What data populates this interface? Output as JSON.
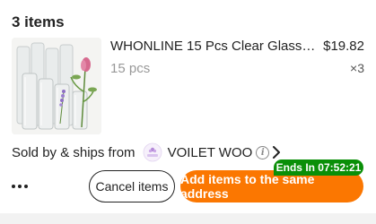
{
  "section": {
    "items_count": "3 items"
  },
  "product": {
    "title": "WHONLINE 15 Pcs Clear Glass Cy...",
    "price": "$19.82",
    "variant": "15 pcs",
    "quantity": "×3"
  },
  "seller": {
    "prefix": "Sold by & ships from",
    "store_name": "VOILET WOO",
    "logo_icon": "voilet-store-logo-icon",
    "info_icon": "info-icon",
    "chevron_icon": "chevron-right-icon"
  },
  "actions": {
    "more_icon": "more-dots-icon",
    "cancel_label": "Cancel items",
    "add_label": "Add items to the same address",
    "timer": "Ends In 07:52:21"
  },
  "colors": {
    "accent": "#fb7701",
    "timer_bg": "#0a8f08",
    "text": "#222222",
    "muted": "#999999"
  }
}
